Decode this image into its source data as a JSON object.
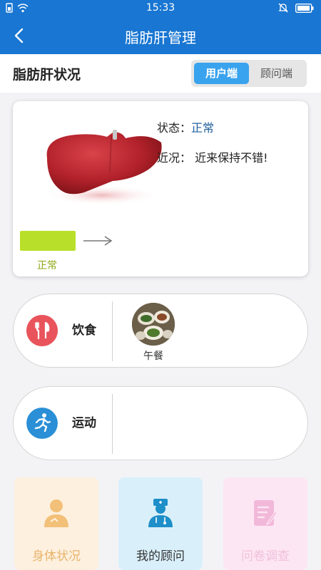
{
  "status_bar": {
    "time": "15:33"
  },
  "nav": {
    "title": "脂肪肝管理"
  },
  "section": {
    "title": "脂肪肝状况",
    "tabs": [
      {
        "label": "用户端",
        "active": true
      },
      {
        "label": "顾问端",
        "active": false
      }
    ]
  },
  "liver_card": {
    "status_label": "状态：",
    "status_value": "正常",
    "recent_label": "近况：",
    "recent_value": "近来保持不错!",
    "level_label": "正常",
    "level_color": "#b8e02a"
  },
  "diet": {
    "label": "饮食",
    "icon": "fork-knife-icon",
    "meal_label": "午餐"
  },
  "exercise": {
    "label": "运动",
    "icon": "running-icon"
  },
  "tiles": [
    {
      "label": "身体状况",
      "icon": "person-icon"
    },
    {
      "label": "我的顾问",
      "icon": "doctor-icon"
    },
    {
      "label": "问卷调查",
      "icon": "questionnaire-icon"
    }
  ],
  "colors": {
    "primary": "#1976d2",
    "accent": "#3aa3ee"
  }
}
